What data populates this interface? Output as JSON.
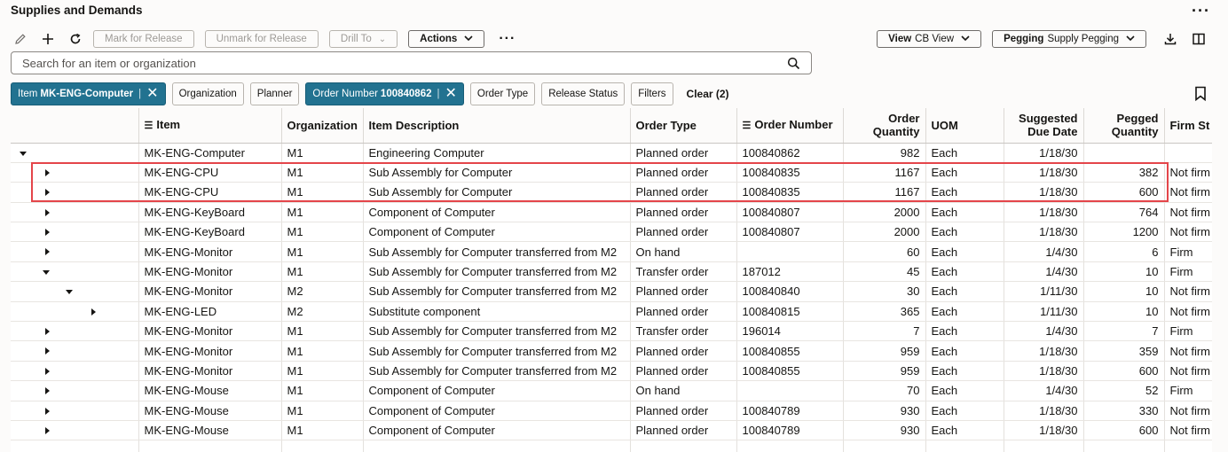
{
  "page": {
    "title": "Supplies and Demands"
  },
  "toolbar": {
    "mark_release": "Mark for Release",
    "unmark_release": "Unmark for Release",
    "drill_to": "Drill To",
    "actions": "Actions",
    "view_prefix": "View",
    "view_value": "CB View",
    "pegging_prefix": "Pegging",
    "pegging_value": "Supply Pegging"
  },
  "search": {
    "placeholder": "Search for an item or organization"
  },
  "filters": {
    "item_label": "Item",
    "item_value": "MK-ENG-Computer",
    "organization": "Organization",
    "planner": "Planner",
    "order_number_label": "Order Number",
    "order_number_value": "100840862",
    "order_type": "Order Type",
    "release_status": "Release Status",
    "filters": "Filters",
    "clear": "Clear (2)"
  },
  "table": {
    "columns": {
      "item": "Item",
      "organization": "Organization",
      "description": "Item Description",
      "order_type": "Order Type",
      "order_number": "Order Number",
      "order_qty_1": "Order",
      "order_qty_2": "Quantity",
      "uom": "UOM",
      "due_1": "Suggested",
      "due_2": "Due Date",
      "pegged_1": "Pegged",
      "pegged_2": "Quantity",
      "firm_status": "Firm St"
    },
    "rows": [
      {
        "level": 0,
        "state": "expanded",
        "item": "MK-ENG-Computer",
        "org": "M1",
        "desc": "Engineering Computer",
        "type": "Planned order",
        "number": "100840862",
        "qty": "982",
        "uom": "Each",
        "due": "1/18/30",
        "pegged": "",
        "firm": ""
      },
      {
        "level": 1,
        "state": "collapsed",
        "item": "MK-ENG-CPU",
        "org": "M1",
        "desc": "Sub Assembly for Computer",
        "type": "Planned order",
        "number": "100840835",
        "qty": "1167",
        "uom": "Each",
        "due": "1/18/30",
        "pegged": "382",
        "firm": "Not firm"
      },
      {
        "level": 1,
        "state": "collapsed",
        "item": "MK-ENG-CPU",
        "org": "M1",
        "desc": "Sub Assembly for Computer",
        "type": "Planned order",
        "number": "100840835",
        "qty": "1167",
        "uom": "Each",
        "due": "1/18/30",
        "pegged": "600",
        "firm": "Not firm"
      },
      {
        "level": 1,
        "state": "collapsed",
        "item": "MK-ENG-KeyBoard",
        "org": "M1",
        "desc": "Component of Computer",
        "type": "Planned order",
        "number": "100840807",
        "qty": "2000",
        "uom": "Each",
        "due": "1/18/30",
        "pegged": "764",
        "firm": "Not firm"
      },
      {
        "level": 1,
        "state": "collapsed",
        "item": "MK-ENG-KeyBoard",
        "org": "M1",
        "desc": "Component of Computer",
        "type": "Planned order",
        "number": "100840807",
        "qty": "2000",
        "uom": "Each",
        "due": "1/18/30",
        "pegged": "1200",
        "firm": "Not firm"
      },
      {
        "level": 1,
        "state": "collapsed",
        "item": "MK-ENG-Monitor",
        "org": "M1",
        "desc": "Sub Assembly for Computer transferred from M2",
        "type": "On hand",
        "number": "",
        "qty": "60",
        "uom": "Each",
        "due": "1/4/30",
        "pegged": "6",
        "firm": "Firm"
      },
      {
        "level": 1,
        "state": "expanded",
        "item": "MK-ENG-Monitor",
        "org": "M1",
        "desc": "Sub Assembly for Computer transferred from M2",
        "type": "Transfer order",
        "number": "187012",
        "qty": "45",
        "uom": "Each",
        "due": "1/4/30",
        "pegged": "10",
        "firm": "Firm"
      },
      {
        "level": 2,
        "state": "expanded",
        "item": "MK-ENG-Monitor",
        "org": "M2",
        "desc": "Sub Assembly for Computer transferred from M2",
        "type": "Planned order",
        "number": "100840840",
        "qty": "30",
        "uom": "Each",
        "due": "1/11/30",
        "pegged": "10",
        "firm": "Not firm"
      },
      {
        "level": 3,
        "state": "collapsed",
        "item": "MK-ENG-LED",
        "org": "M2",
        "desc": "Substitute component",
        "type": "Planned order",
        "number": "100840815",
        "qty": "365",
        "uom": "Each",
        "due": "1/11/30",
        "pegged": "10",
        "firm": "Not firm"
      },
      {
        "level": 1,
        "state": "collapsed",
        "item": "MK-ENG-Monitor",
        "org": "M1",
        "desc": "Sub Assembly for Computer transferred from M2",
        "type": "Transfer order",
        "number": "196014",
        "qty": "7",
        "uom": "Each",
        "due": "1/4/30",
        "pegged": "7",
        "firm": "Firm"
      },
      {
        "level": 1,
        "state": "collapsed",
        "item": "MK-ENG-Monitor",
        "org": "M1",
        "desc": "Sub Assembly for Computer transferred from M2",
        "type": "Planned order",
        "number": "100840855",
        "qty": "959",
        "uom": "Each",
        "due": "1/18/30",
        "pegged": "359",
        "firm": "Not firm"
      },
      {
        "level": 1,
        "state": "collapsed",
        "item": "MK-ENG-Monitor",
        "org": "M1",
        "desc": "Sub Assembly for Computer transferred from M2",
        "type": "Planned order",
        "number": "100840855",
        "qty": "959",
        "uom": "Each",
        "due": "1/18/30",
        "pegged": "600",
        "firm": "Not firm"
      },
      {
        "level": 1,
        "state": "collapsed",
        "item": "MK-ENG-Mouse",
        "org": "M1",
        "desc": "Component of Computer",
        "type": "On hand",
        "number": "",
        "qty": "70",
        "uom": "Each",
        "due": "1/4/30",
        "pegged": "52",
        "firm": "Firm"
      },
      {
        "level": 1,
        "state": "collapsed",
        "item": "MK-ENG-Mouse",
        "org": "M1",
        "desc": "Component of Computer",
        "type": "Planned order",
        "number": "100840789",
        "qty": "930",
        "uom": "Each",
        "due": "1/18/30",
        "pegged": "330",
        "firm": "Not firm"
      },
      {
        "level": 1,
        "state": "collapsed",
        "item": "MK-ENG-Mouse",
        "org": "M1",
        "desc": "Component of Computer",
        "type": "Planned order",
        "number": "100840789",
        "qty": "930",
        "uom": "Each",
        "due": "1/18/30",
        "pegged": "600",
        "firm": "Not firm"
      }
    ]
  },
  "colors": {
    "chip_active": "#227290",
    "highlight": "#e4454a"
  },
  "icons": [
    "edit-pencil-icon",
    "add-icon",
    "refresh-icon",
    "more-horizontal-icon",
    "chevron-down-icon",
    "download-icon",
    "split-view-icon",
    "search-icon",
    "close-icon",
    "bookmark-icon",
    "sort-icon"
  ]
}
